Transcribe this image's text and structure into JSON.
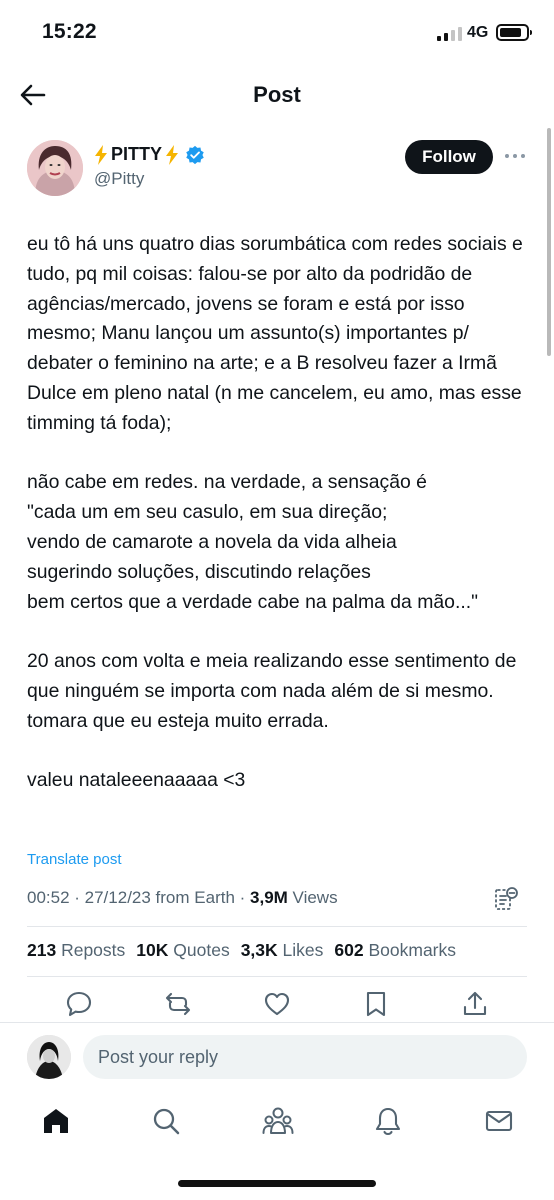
{
  "status_bar": {
    "time": "15:22",
    "network": "4G"
  },
  "nav": {
    "title": "Post"
  },
  "author": {
    "display_name": "PITTY",
    "handle": "@Pitty",
    "follow_label": "Follow"
  },
  "post": {
    "paragraphs": [
      "eu tô há uns quatro dias sorumbática com redes sociais e tudo, pq mil coisas: falou-se por alto da podridão de agências/mercado, jovens se foram e está por isso mesmo; Manu lançou um assunto(s) importantes p/ debater o feminino na arte; e a B resolveu fazer a Irmã Dulce em pleno natal (n me cancelem, eu amo, mas esse timming tá foda);",
      "não cabe em redes. na verdade, a sensação é",
      "\"cada um em seu casulo, em sua direção;",
      "vendo de camarote a novela da vida alheia",
      "sugerindo soluções, discutindo relações",
      "bem certos que a verdade cabe na palma da mão...\"",
      "20 anos com volta e meia realizando esse sentimento de que ninguém se importa com nada além de si mesmo. tomara que eu esteja muito errada.",
      "valeu nataleeenaaaaa <3"
    ],
    "translate_label": "Translate post",
    "timestamp": "00:52 · 27/12/23 from Earth · ",
    "views_count": "3,9M",
    "views_label": " Views"
  },
  "stats": {
    "reposts_count": "213",
    "reposts_label": "Reposts",
    "quotes_count": "10K",
    "quotes_label": "Quotes",
    "likes_count": "3,3K",
    "likes_label": "Likes",
    "bookmarks_count": "602",
    "bookmarks_label": "Bookmarks"
  },
  "reply": {
    "placeholder": "Post your reply"
  },
  "colors": {
    "accent": "#1d9bf0",
    "text_primary": "#0f1419",
    "text_secondary": "#536471",
    "verified": "#1d9bf0"
  },
  "icons": {
    "back": "arrow-left-icon",
    "more": "more-horizontal-icon",
    "reply": "speech-bubble-icon",
    "repost": "repost-arrows-icon",
    "like": "heart-icon",
    "bookmark": "bookmark-icon",
    "share": "share-upload-icon",
    "home": "home-icon",
    "search": "search-icon",
    "communities": "people-icon",
    "notifications": "bell-icon",
    "messages": "envelope-icon"
  }
}
